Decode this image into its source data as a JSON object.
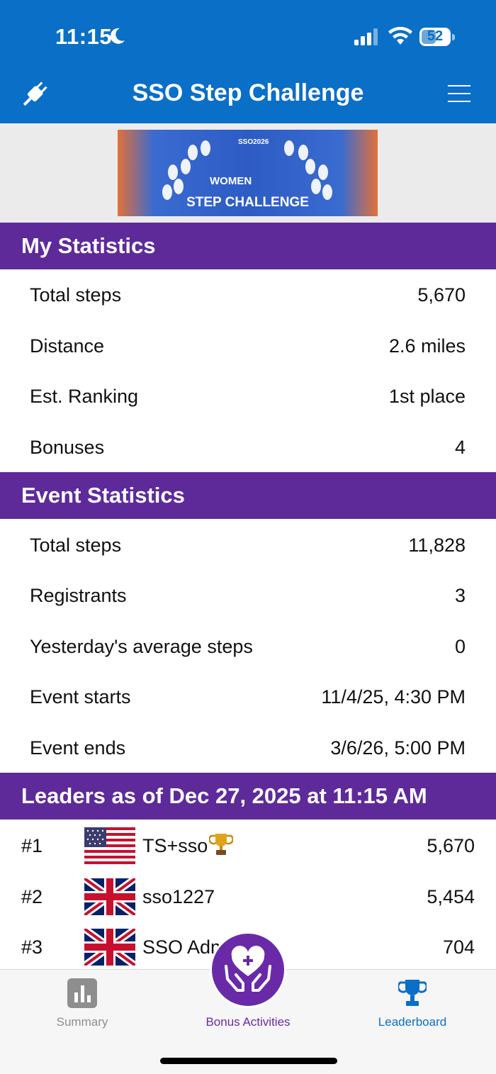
{
  "status_bar": {
    "time": "11:15",
    "battery": "52",
    "battery_level": 0.52
  },
  "header": {
    "title": "SSO Step Challenge"
  },
  "banner": {
    "org": "SSO2026",
    "group": "WOMEN",
    "title": "STEP CHALLENGE"
  },
  "my_statistics": {
    "heading": "My Statistics",
    "rows": [
      {
        "label": "Total steps",
        "value": "5,670"
      },
      {
        "label": "Distance",
        "value": "2.6 miles"
      },
      {
        "label": "Est. Ranking",
        "value": "1st place"
      },
      {
        "label": "Bonuses",
        "value": "4"
      }
    ]
  },
  "event_statistics": {
    "heading": "Event Statistics",
    "rows": [
      {
        "label": "Total steps",
        "value": "11,828"
      },
      {
        "label": "Registrants",
        "value": "3"
      },
      {
        "label": "Yesterday's average steps",
        "value": "0"
      },
      {
        "label": "Event starts",
        "value": "11/4/25, 4:30 PM"
      },
      {
        "label": "Event ends",
        "value": "3/6/26, 5:00 PM"
      }
    ]
  },
  "leaders": {
    "heading": "Leaders as of Dec 27, 2025 at 11:15 AM",
    "rows": [
      {
        "rank": "#1",
        "flag": "us-flag",
        "name": "TS+sso",
        "steps": "5,670"
      },
      {
        "rank": "#2",
        "flag": "uk-flag",
        "name": "sso1227",
        "steps": "5,454"
      },
      {
        "rank": "#3",
        "flag": "uk-flag",
        "name": "SSO Adm",
        "steps": "704"
      }
    ]
  },
  "tabs": [
    {
      "label": "Summary",
      "icon": "bar-chart-icon",
      "color": "#8e8e8e"
    },
    {
      "label": "Bonus Activities",
      "icon": "heart-hands-icon",
      "color": "#6a2aa8"
    },
    {
      "label": "Leaderboard",
      "icon": "trophy-icon",
      "color": "#0a6fc7"
    }
  ],
  "colors": {
    "brand_blue": "#0a6fc7",
    "section_purple": "#5e2a9a",
    "accent_purple": "#6a2aa8"
  }
}
